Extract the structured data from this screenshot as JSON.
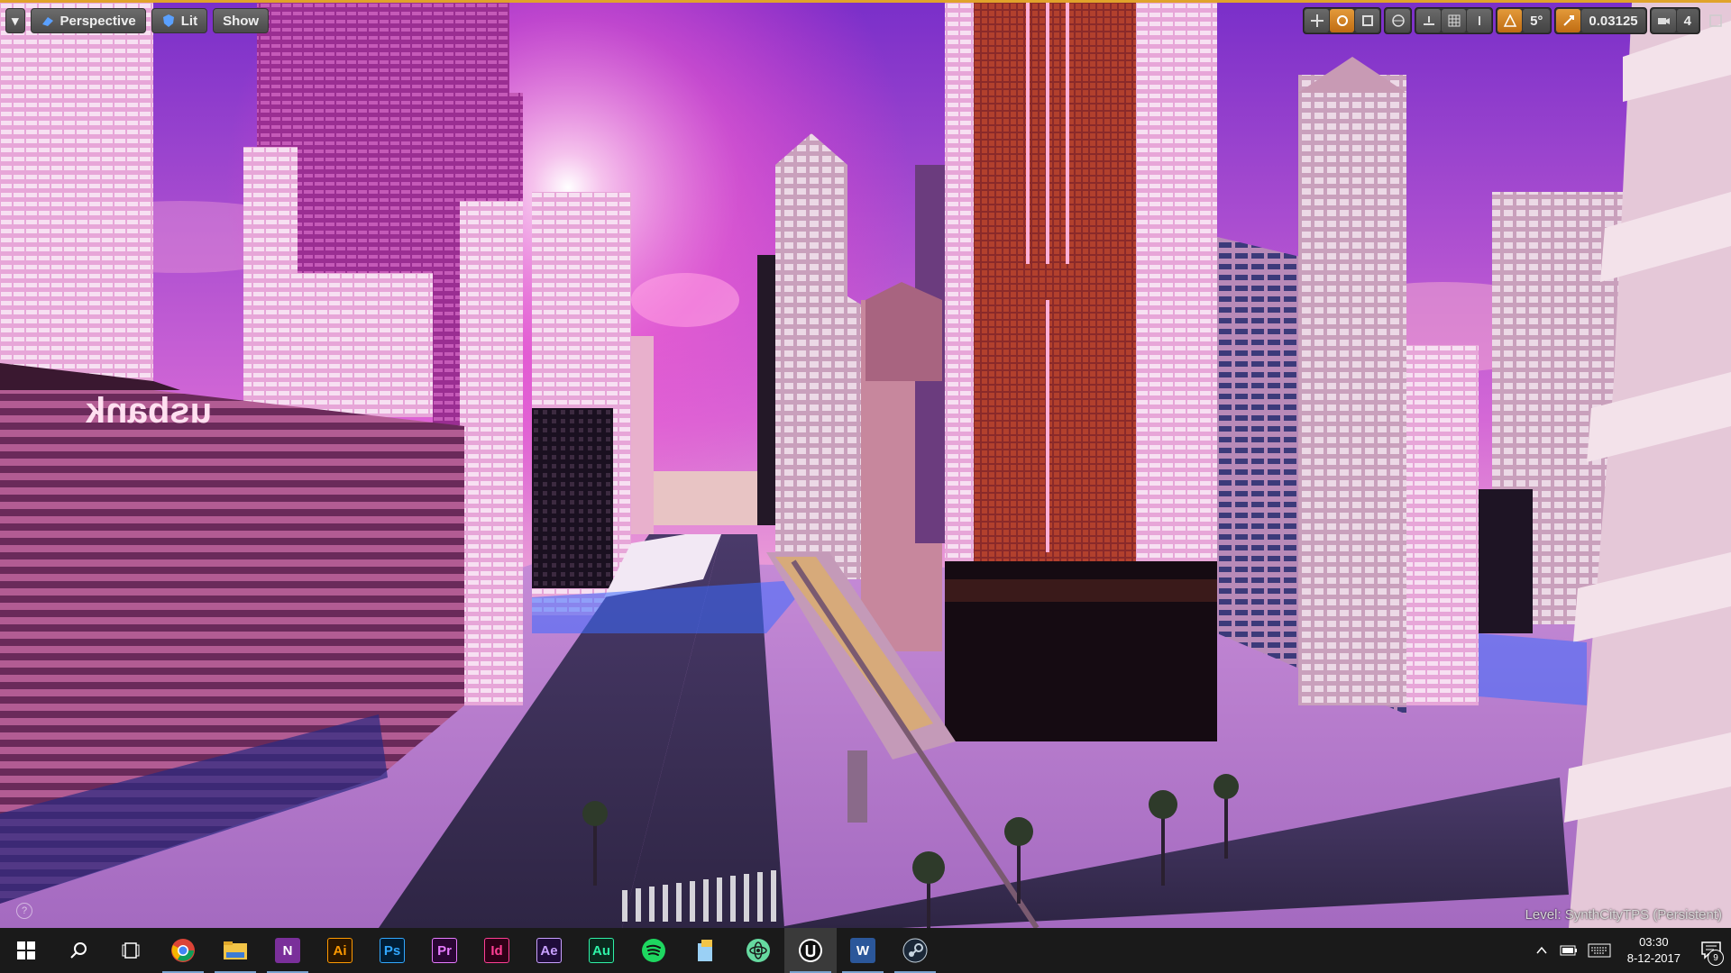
{
  "viewport": {
    "menu_arrow": "▾",
    "perspective_label": "Perspective",
    "lit_label": "Lit",
    "show_label": "Show",
    "rotation_snap": "5°",
    "scale_snap": "0.03125",
    "camera_speed": "4",
    "level_prefix": "Level:",
    "level_name": "SynthCityTPS (Persistent)",
    "billboard_text": "usbank",
    "help_label": "?"
  },
  "toolbar_icons": [
    "translate-icon",
    "rotate-icon",
    "scale-icon",
    "world-icon",
    "surface-snap-icon",
    "grid-snap-icon",
    "grid-size-icon",
    "rotation-snap-icon",
    "scale-snap-icon",
    "camera-speed-icon",
    "maximize-icon"
  ],
  "taskbar": {
    "apps": [
      {
        "name": "start-icon",
        "label": ""
      },
      {
        "name": "search-icon",
        "label": ""
      },
      {
        "name": "task-view-icon",
        "label": ""
      },
      {
        "name": "chrome-icon",
        "label": ""
      },
      {
        "name": "file-explorer-icon",
        "label": ""
      },
      {
        "name": "onenote-icon",
        "label": "N"
      },
      {
        "name": "illustrator-icon",
        "label": "Ai"
      },
      {
        "name": "photoshop-icon",
        "label": "Ps"
      },
      {
        "name": "premiere-icon",
        "label": "Pr"
      },
      {
        "name": "indesign-icon",
        "label": "Id"
      },
      {
        "name": "after-effects-icon",
        "label": "Ae"
      },
      {
        "name": "audition-icon",
        "label": "Au"
      },
      {
        "name": "spotify-icon",
        "label": ""
      },
      {
        "name": "files-icon",
        "label": ""
      },
      {
        "name": "atom-icon",
        "label": ""
      },
      {
        "name": "unreal-engine-icon",
        "label": ""
      },
      {
        "name": "word-icon",
        "label": "W"
      },
      {
        "name": "steam-icon",
        "label": ""
      }
    ],
    "time": "03:30",
    "date": "8-12-2017",
    "notification_count": "9"
  },
  "colors": {
    "accent": "#e0a32a",
    "sky_top": "#8a3fd1",
    "sky_glow": "#ff7adf",
    "building_pink": "#d07bb0",
    "taskbar": "#1a1a1a"
  }
}
